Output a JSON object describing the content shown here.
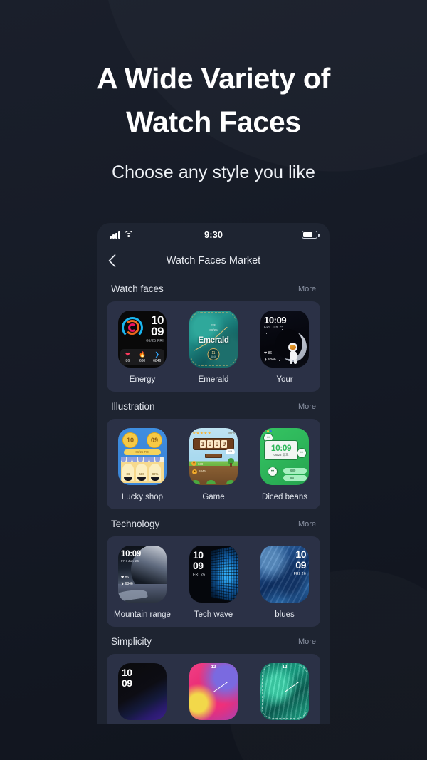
{
  "hero": {
    "title_line1": "A Wide Variety of",
    "title_line2": "Watch Faces",
    "subtitle": "Choose any style you like"
  },
  "phone": {
    "status_bar": {
      "time": "9:30",
      "signal_icon": "cellular-bars-icon",
      "wifi_icon": "wifi-icon",
      "battery_icon": "battery-icon"
    },
    "nav": {
      "back_icon": "chevron-left-icon",
      "title": "Watch Faces Market"
    }
  },
  "sections": [
    {
      "title": "Watch faces",
      "more": "More",
      "faces": [
        {
          "name": "Energy",
          "time_hour": "10",
          "time_min": "09",
          "date": "06/25  FRI",
          "stats": [
            {
              "icon": "heart-icon",
              "value": "86",
              "color": "#ff3a5e"
            },
            {
              "icon": "flame-icon",
              "value": "680",
              "color": "#ff8a1f"
            },
            {
              "icon": "shoe-icon",
              "value": "6846",
              "color": "#2fa7ff"
            }
          ]
        },
        {
          "name": "Emerald",
          "label": "Emerald",
          "day": "FRI",
          "date": "06/25",
          "badge_value": "11",
          "badge_sub": "6846"
        },
        {
          "name": "Your",
          "time": "10:09",
          "date": "FRI   Jun 25",
          "stats": [
            {
              "icon": "heart-icon",
              "value": "86"
            },
            {
              "icon": "shoe-icon",
              "value": "6846"
            }
          ]
        }
      ]
    },
    {
      "title": "Illustration",
      "more": "More",
      "faces": [
        {
          "name": "Lucky shop",
          "coin_left": "10",
          "coin_right": "09",
          "date": "06/25  FRI",
          "cols": [
            "86",
            "680",
            "80%"
          ]
        },
        {
          "name": "Game",
          "digits": [
            "1",
            "0",
            "0",
            "9"
          ],
          "stars": "★★★★★",
          "pct": "80%",
          "cloud": "AM",
          "stat1": "680",
          "stat2": "6846"
        },
        {
          "name": "Diced beans",
          "time": "10:09",
          "date": "06/23 周三",
          "pill1": "680",
          "pill2": "86"
        }
      ]
    },
    {
      "title": "Technology",
      "more": "More",
      "faces": [
        {
          "name": "Mountain range",
          "time": "10:09",
          "date": "FRI   Jun 25",
          "stats": [
            {
              "icon": "heart-icon",
              "value": "86"
            },
            {
              "icon": "shoe-icon",
              "value": "6846"
            }
          ]
        },
        {
          "name": "Tech wave",
          "time_hour": "10",
          "time_min": "09",
          "date": "FRI 26"
        },
        {
          "name": "blues",
          "time_hour": "10",
          "time_min": "09",
          "date": "FRI 26"
        }
      ]
    },
    {
      "title": "Simplicity",
      "more": "More",
      "faces": [
        {
          "name": "",
          "time_hour": "10",
          "time_min": "09"
        },
        {
          "name": "",
          "marker": "12"
        },
        {
          "name": "",
          "marker": "12"
        }
      ]
    }
  ]
}
